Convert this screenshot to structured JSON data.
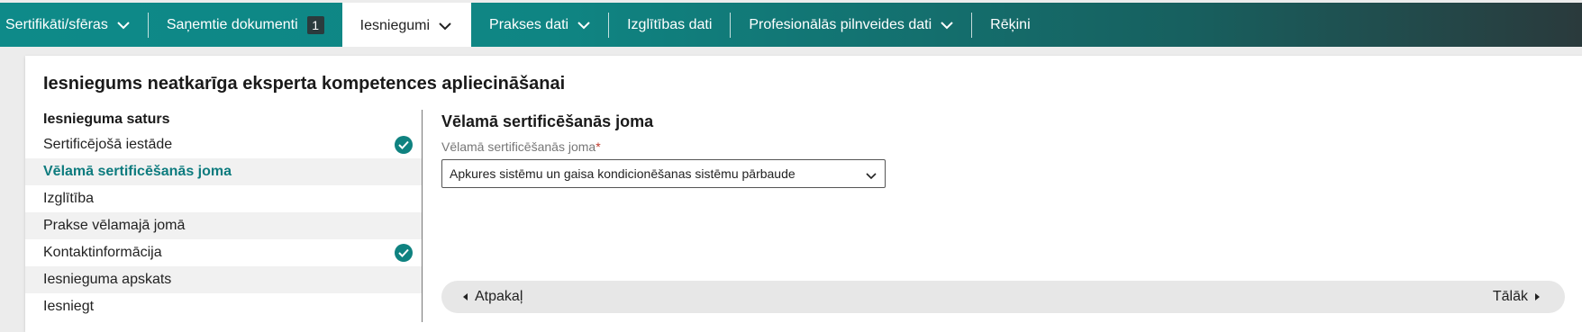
{
  "nav": {
    "items": [
      {
        "label": "Sertifikāti/sfēras",
        "has_dropdown": true
      },
      {
        "label": "Saņemtie dokumenti",
        "badge": "1"
      },
      {
        "label": "Iesniegumi",
        "has_dropdown": true,
        "active": true
      },
      {
        "label": "Prakses dati",
        "has_dropdown": true
      },
      {
        "label": "Izglītības dati"
      },
      {
        "label": "Profesionālās pilnveides dati",
        "has_dropdown": true
      },
      {
        "label": "Rēķini"
      }
    ]
  },
  "page": {
    "title": "Iesniegums neatkarīga eksperta kompetences apliecināšanai"
  },
  "sidebar": {
    "heading": "Iesnieguma saturs",
    "items": [
      {
        "label": "Sertificējošā iestāde",
        "completed": true
      },
      {
        "label": "Vēlamā sertificēšanās joma",
        "current": true
      },
      {
        "label": "Izglītība"
      },
      {
        "label": "Prakse vēlamajā jomā"
      },
      {
        "label": "Kontaktinformācija",
        "completed": true
      },
      {
        "label": "Iesnieguma apskats"
      },
      {
        "label": "Iesniegt"
      }
    ]
  },
  "panel": {
    "title": "Vēlamā sertificēšanās joma",
    "field_label": "Vēlamā sertificēšanās joma",
    "required_marker": "*",
    "select_value": "Apkures sistēmu un gaisa kondicionēšanas sistēmu pārbaude"
  },
  "wizard": {
    "back_label": "Atpakaļ",
    "next_label": "Tālāk"
  },
  "colors": {
    "accent": "#0f8280",
    "current_item": "#0d7b7e",
    "nav_gradient_start": "#0e8a89",
    "nav_gradient_end": "#2a3a3c",
    "required": "#c0392b"
  },
  "icons": {
    "dropdown": "chevron-down-icon",
    "completed": "check-circle-icon",
    "back": "caret-left-icon",
    "next": "caret-right-icon"
  }
}
